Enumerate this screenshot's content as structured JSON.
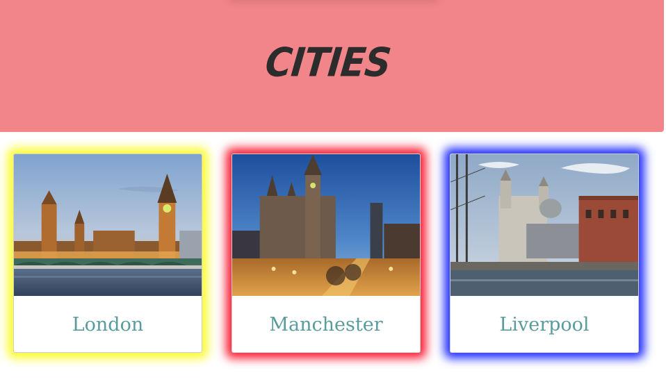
{
  "header": {
    "title": "CITIES",
    "background": "#f1858a"
  },
  "cards": [
    {
      "label": "London",
      "glow": "#fcfb2b",
      "image": "london-big-ben-photo"
    },
    {
      "label": "Manchester",
      "glow": "#f81c33",
      "image": "manchester-town-hall-photo"
    },
    {
      "label": "Liverpool",
      "glow": "#1f2cff",
      "image": "liverpool-waterfront-photo"
    }
  ],
  "colors": {
    "label_text": "#5a9c9c",
    "title_text": "#2c2c2c"
  }
}
